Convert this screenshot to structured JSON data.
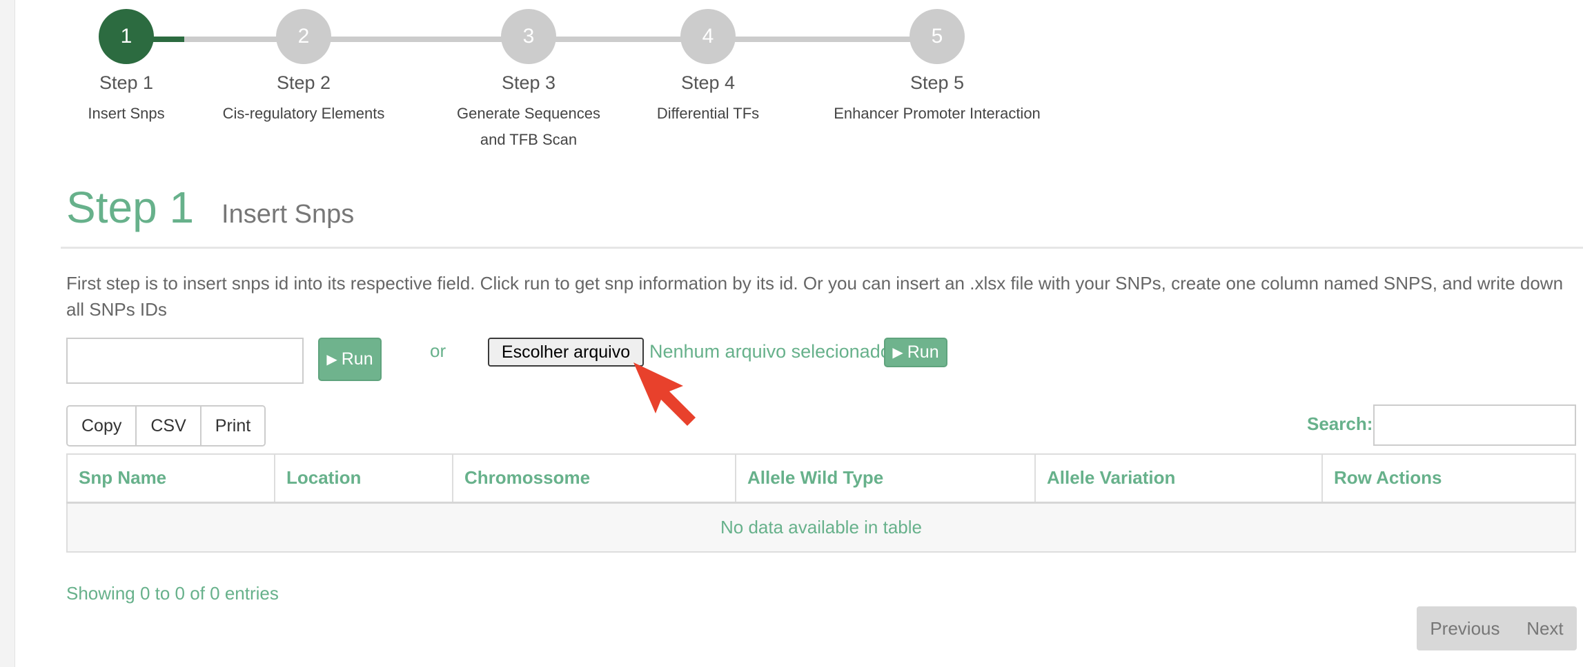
{
  "stepper": {
    "steps": [
      {
        "number": "1",
        "title": "Step 1",
        "subtitle": "Insert Snps",
        "state": "active"
      },
      {
        "number": "2",
        "title": "Step 2",
        "subtitle": "Cis-regulatory Elements",
        "state": "pending"
      },
      {
        "number": "3",
        "title": "Step 3",
        "subtitle": "Generate Sequences and TFB Scan",
        "state": "pending"
      },
      {
        "number": "4",
        "title": "Step 4",
        "subtitle": "Differential TFs",
        "state": "pending"
      },
      {
        "number": "5",
        "title": "Step 5",
        "subtitle": "Enhancer Promoter Interaction",
        "state": "pending"
      }
    ],
    "colors": {
      "active": "#2c6b40",
      "pending": "#cccccc"
    }
  },
  "heading": {
    "title": "Step 1",
    "subtitle": "Insert Snps"
  },
  "intro_text": "First step is to insert snps id into its respective field. Click run to get snp information by its id. Or you can insert an .xlsx file with your SNPs, create one column named SNPS, and write down all SNPs IDs",
  "snp_form": {
    "input_value": "",
    "run_label": "Run",
    "run_icon": "play-icon",
    "or_label": "or",
    "file_button_label": "Escolher arquivo",
    "file_status": "Nenhum arquivo selecionado",
    "file_run_label": "Run"
  },
  "export_buttons": [
    "Copy",
    "CSV",
    "Print"
  ],
  "search": {
    "label": "Search:",
    "value": ""
  },
  "table": {
    "columns": [
      "Snp Name",
      "Location",
      "Chromossome",
      "Allele Wild Type",
      "Allele Variation",
      "Row Actions"
    ],
    "empty_message": "No data available in table"
  },
  "info_text": "Showing 0 to 0 of 0 entries",
  "pagination": {
    "previous": "Previous",
    "next": "Next"
  },
  "theme": {
    "accent": "#67b18b",
    "button": "#6fb38d",
    "annotation_arrow": "#e8412c"
  }
}
